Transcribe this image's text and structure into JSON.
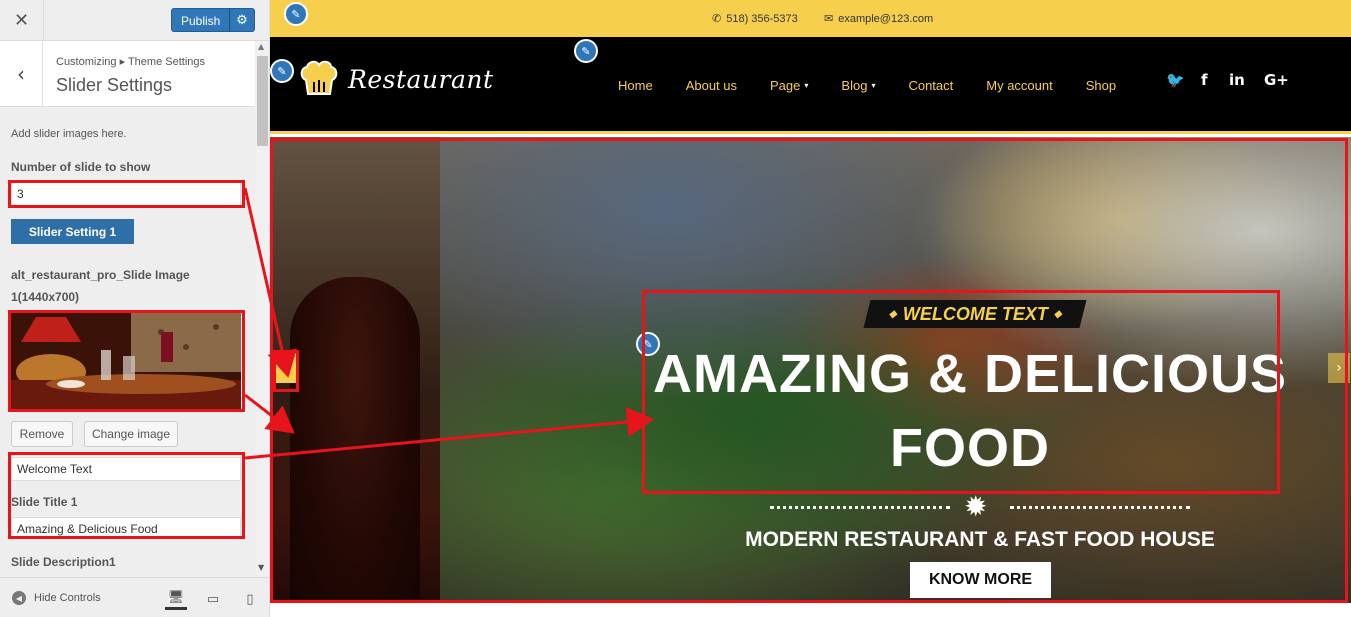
{
  "sidebar": {
    "close_glyph": "✕",
    "publish_label": "Publish",
    "settings_glyph": "⚙",
    "back_glyph": "‹",
    "breadcrumb": "Customizing ▸ Theme Settings",
    "section_title": "Slider Settings",
    "description": "Add slider images here.",
    "slides_count_label": "Number of slide to show",
    "slides_count_value": "3",
    "slider_setting_button": "Slider Setting 1",
    "image_label_line1": "alt_restaurant_pro_Slide Image",
    "image_label_line2": "1(1440x700)",
    "remove_button": "Remove",
    "change_image_button": "Change image",
    "welcome_text_value": "Welcome Text",
    "slide_title_label": "Slide Title 1",
    "slide_title_value": "Amazing & Delicious Food",
    "slide_description_label": "Slide Description1",
    "hide_controls_label": "Hide Controls",
    "hide_controls_glyph": "◀",
    "device_desktop_glyph": "🖥",
    "device_tablet_glyph": "▭",
    "device_mobile_glyph": "▯",
    "scroll_up_glyph": "▲",
    "scroll_down_glyph": "▼"
  },
  "preview": {
    "phone_glyph": "✆",
    "phone": "518) 356-5373",
    "email_glyph": "✉",
    "email": "example@123.com",
    "logo_text": "Restaurant",
    "nav": [
      {
        "label": "Home",
        "has_caret": false
      },
      {
        "label": "About us",
        "has_caret": false
      },
      {
        "label": "Page",
        "has_caret": true
      },
      {
        "label": "Blog",
        "has_caret": true
      },
      {
        "label": "Contact",
        "has_caret": false
      },
      {
        "label": "My account",
        "has_caret": false
      },
      {
        "label": "Shop",
        "has_caret": false
      }
    ],
    "caret_glyph": "▾",
    "social": {
      "twitter": "🐦",
      "facebook": "f",
      "linkedin": "in",
      "googleplus": "G+"
    },
    "pencil_glyph": "✎",
    "slider": {
      "welcome": "WELCOME TEXT",
      "diamond_glyph": "◆",
      "title": "AMAZING & DELICIOUS FOOD",
      "subtitle": "MODERN RESTAURANT & FAST FOOD HOUSE",
      "button": "KNOW MORE",
      "prev_glyph": "‹",
      "next_glyph": "›",
      "burst_glyph": "✹"
    }
  },
  "colors": {
    "accent_yellow": "#f6d04d",
    "publish_blue": "#2f77b8",
    "annotation_red": "#e8141b",
    "nav_bg": "#000000"
  }
}
